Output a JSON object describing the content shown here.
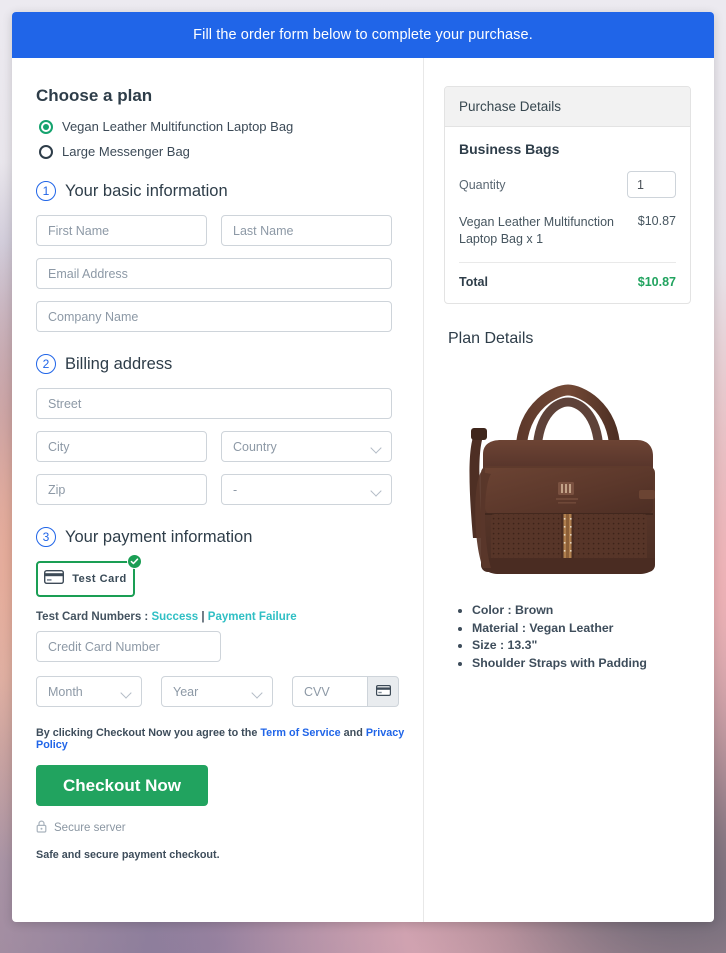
{
  "banner": {
    "text": "Fill the order form below to complete your purchase."
  },
  "plan": {
    "heading": "Choose a plan",
    "options": [
      {
        "label": "Vegan Leather Multifunction Laptop Bag",
        "selected": true
      },
      {
        "label": "Large Messenger Bag",
        "selected": false
      }
    ]
  },
  "steps": {
    "basic": {
      "number": "1",
      "title": "Your basic information"
    },
    "billing": {
      "number": "2",
      "title": "Billing address"
    },
    "payment": {
      "number": "3",
      "title": "Your payment information"
    }
  },
  "basic_fields": {
    "first_name": "First Name",
    "last_name": "Last Name",
    "email": "Email Address",
    "company": "Company Name"
  },
  "billing_fields": {
    "street": "Street",
    "city": "City",
    "country": "Country",
    "zip": "Zip",
    "state": "-"
  },
  "payment": {
    "card_button_label": "Test  Card",
    "card_icon": "credit-card-icon",
    "badge_icon": "check-circle-icon",
    "test_cards_label": "Test Card Numbers :",
    "success_link": "Success",
    "separator": "|",
    "failure_link": "Payment Failure",
    "credit_card_number": "Credit Card Number",
    "month": "Month",
    "year": "Year",
    "cvv": "CVV",
    "cvv_icon": "credit-card-icon"
  },
  "terms": {
    "prefix": "By clicking Checkout Now you agree to the",
    "tos_link": "Term of Service",
    "conjunction": "and",
    "privacy_link": "Privacy Policy"
  },
  "checkout": {
    "button_label": "Checkout Now",
    "secure_icon": "lock-icon",
    "secure_label": "Secure server",
    "safe_note": "Safe and secure payment checkout."
  },
  "purchase": {
    "header": "Purchase Details",
    "group_title": "Business Bags",
    "quantity_label": "Quantity",
    "quantity_value": "1",
    "item_name": "Vegan Leather Multifunction Laptop Bag x 1",
    "item_price": "$10.87",
    "total_label": "Total",
    "total_value": "$10.87"
  },
  "plan_details": {
    "title": "Plan Details",
    "image_alt": "vegan-leather-laptop-bag",
    "specs": [
      "Color : Brown",
      "Material : Vegan Leather",
      "Size : 13.3\"",
      "Shoulder Straps with Padding"
    ]
  },
  "colors": {
    "banner_blue": "#2065e8",
    "accent_green": "#21a35f",
    "link_teal": "#2fbfc4",
    "link_blue": "#2065e8",
    "heading_navy": "#2e3d49"
  }
}
